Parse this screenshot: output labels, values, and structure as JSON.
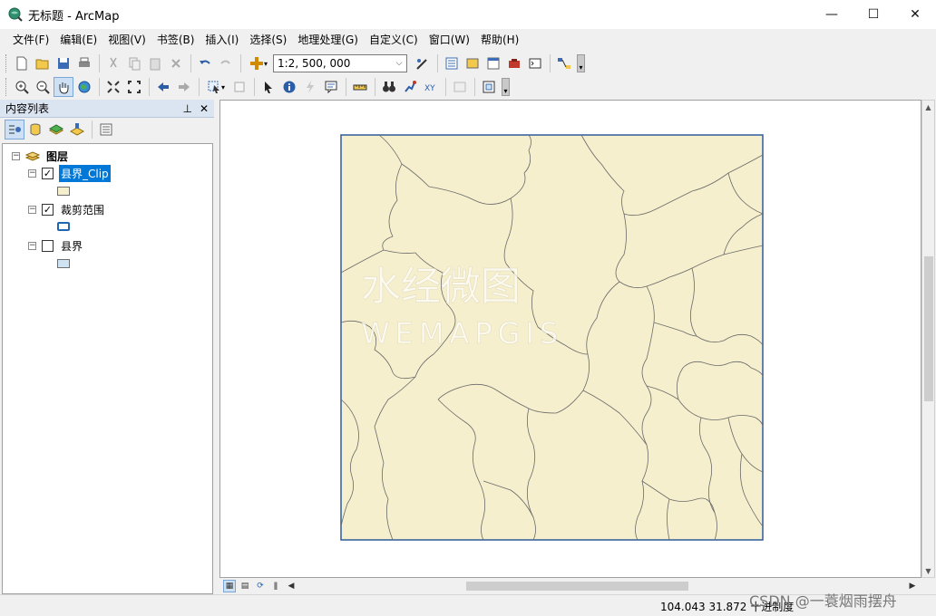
{
  "window": {
    "title": "无标题 - ArcMap",
    "minimize": "—",
    "maximize": "☐",
    "close": "✕"
  },
  "menu": [
    "文件(F)",
    "编辑(E)",
    "视图(V)",
    "书签(B)",
    "插入(I)",
    "选择(S)",
    "地理处理(G)",
    "自定义(C)",
    "窗口(W)",
    "帮助(H)"
  ],
  "toolbar": {
    "scale_value": "1:2, 500, 000"
  },
  "toc": {
    "title": "内容列表",
    "pin": "ᵖ",
    "close": "✕",
    "root_label": "图层",
    "layers": [
      {
        "name": "县界_Clip",
        "checked": true,
        "selected": true,
        "swatch_fill": "#f5efcd",
        "swatch_border": "#6e6e6e"
      },
      {
        "name": "裁剪范围",
        "checked": true,
        "selected": false,
        "swatch_fill": "#ffffff",
        "swatch_border": "#1f67b4"
      },
      {
        "name": "县界",
        "checked": false,
        "selected": false,
        "swatch_fill": "#cfe3f2",
        "swatch_border": "#6e6e6e"
      }
    ]
  },
  "map": {
    "fill_color": "#f5efcd",
    "border_color": "#2f5b9a",
    "line_color": "#6a6a6a",
    "watermark_cn": "水经微图",
    "watermark_en": "WEMAPGIS"
  },
  "status": {
    "coords": "104.043  31.872  十进制度"
  },
  "watermark": "CSDN @一蓑烟雨摆舟"
}
